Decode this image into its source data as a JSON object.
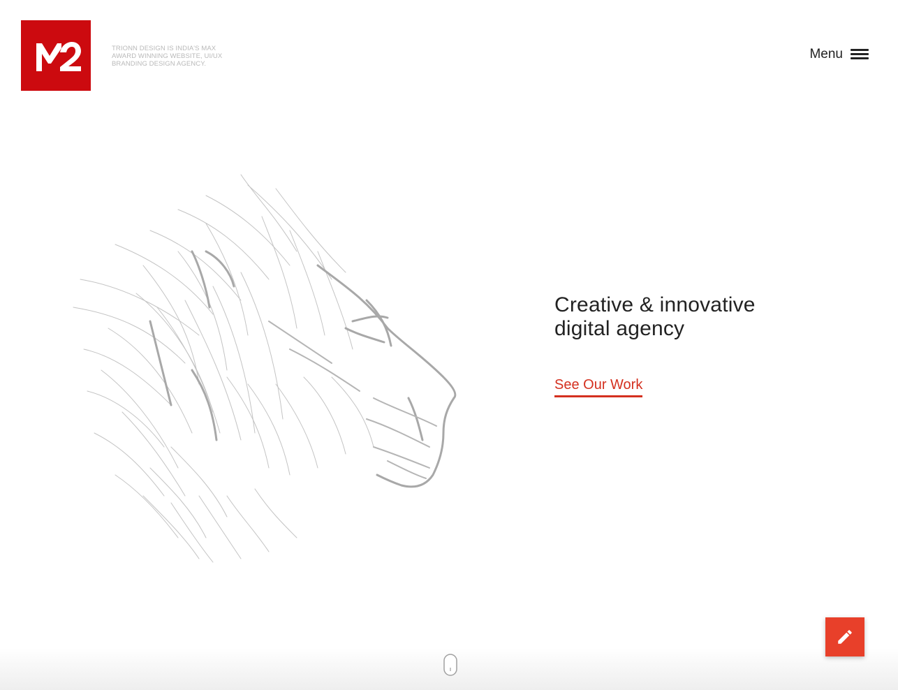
{
  "header": {
    "logo_text": "M2",
    "tagline": [
      "TRIONN DESIGN IS INDIA'S MAX",
      "AWARD WINNING WEBSITE, UI/UX",
      "BRANDING DESIGN AGENCY."
    ],
    "menu_label": "Menu"
  },
  "hero": {
    "title_line1": "Creative & innovative",
    "title_line2": "digital agency",
    "cta_label": "See Our Work"
  },
  "icons": {
    "logo": "m2-logo-icon",
    "menu": "hamburger-icon",
    "illustration": "lion-sketch-illustration",
    "fab": "pencil-icon",
    "scroll": "mouse-scroll-icon"
  },
  "colors": {
    "brand_red": "#cc0a0f",
    "accent_red": "#d4301f",
    "fab_red": "#e8402a",
    "text_dark": "#222222",
    "tagline_gray": "#b9b9b9"
  }
}
